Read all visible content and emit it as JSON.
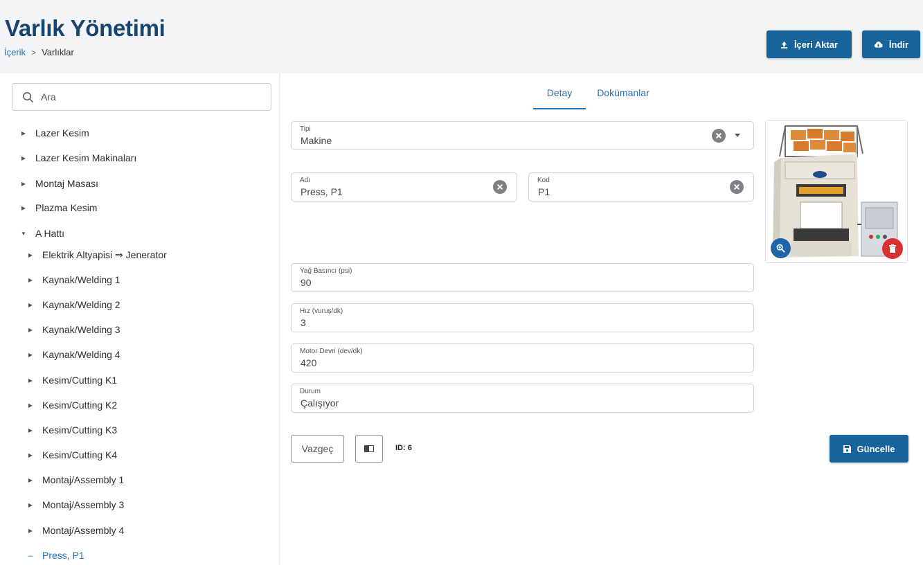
{
  "header": {
    "title": "Varlık Yönetimi",
    "breadcrumb": {
      "link": "İçerik",
      "separator": ">",
      "current": "Varlıklar"
    },
    "import_label": "İçeri Aktar",
    "download_label": "İndir"
  },
  "search": {
    "placeholder": "Ara"
  },
  "tree": {
    "items": [
      {
        "label": "Lazer Kesim",
        "expanded": false
      },
      {
        "label": "Lazer Kesim Makinaları",
        "expanded": false
      },
      {
        "label": "Montaj Masası",
        "expanded": false
      },
      {
        "label": "Plazma Kesim",
        "expanded": false
      },
      {
        "label": "A Hattı",
        "expanded": true
      },
      {
        "label": "Elektrik Altyapisi ⇒ Jenerator",
        "expanded": false
      },
      {
        "label": "Kaynak/Welding 1",
        "expanded": false
      },
      {
        "label": "Kaynak/Welding 2",
        "expanded": false
      },
      {
        "label": "Kaynak/Welding 3",
        "expanded": false
      },
      {
        "label": "Kaynak/Welding 4",
        "expanded": false
      },
      {
        "label": "Kesim/Cutting K1",
        "expanded": false
      },
      {
        "label": "Kesim/Cutting K2",
        "expanded": false
      },
      {
        "label": "Kesim/Cutting K3",
        "expanded": false
      },
      {
        "label": "Kesim/Cutting K4",
        "expanded": false
      },
      {
        "label": "Montaj/Assembly 1",
        "expanded": false
      },
      {
        "label": "Montaj/Assembly 3",
        "expanded": false
      },
      {
        "label": "Montaj/Assembly 4",
        "expanded": false
      },
      {
        "label": "Press, P1",
        "selected": true
      }
    ]
  },
  "tabs": [
    {
      "label": "Detay",
      "active": true
    },
    {
      "label": "Dokümanlar",
      "active": false
    }
  ],
  "form": {
    "type": {
      "label": "Tipi",
      "value": "Makine"
    },
    "name": {
      "label": "Adı",
      "value": "Press, P1"
    },
    "code": {
      "label": "Kod",
      "value": "P1"
    },
    "oil_pressure": {
      "label": "Yağ Basıncı (psi)",
      "value": "90"
    },
    "speed": {
      "label": "Hız (vuruş/dk)",
      "value": "3"
    },
    "motor_rpm": {
      "label": "Motor Devri (dev/dk)",
      "value": "420"
    },
    "status": {
      "label": "Durum",
      "value": "Çalışıyor"
    }
  },
  "actions": {
    "cancel_label": "Vazgeç",
    "id_label": "ID: 6",
    "update_label": "Güncelle"
  },
  "colors": {
    "primary": "#17649d",
    "title": "#16456f",
    "link": "#2a6fb0",
    "danger": "#d93131"
  },
  "icons": {
    "import": "upload-icon",
    "download": "cloud-download-icon",
    "search": "search-icon",
    "clear": "clear-circle-icon",
    "zoom": "zoom-in-icon",
    "delete": "trash-icon",
    "update": "save-icon"
  }
}
